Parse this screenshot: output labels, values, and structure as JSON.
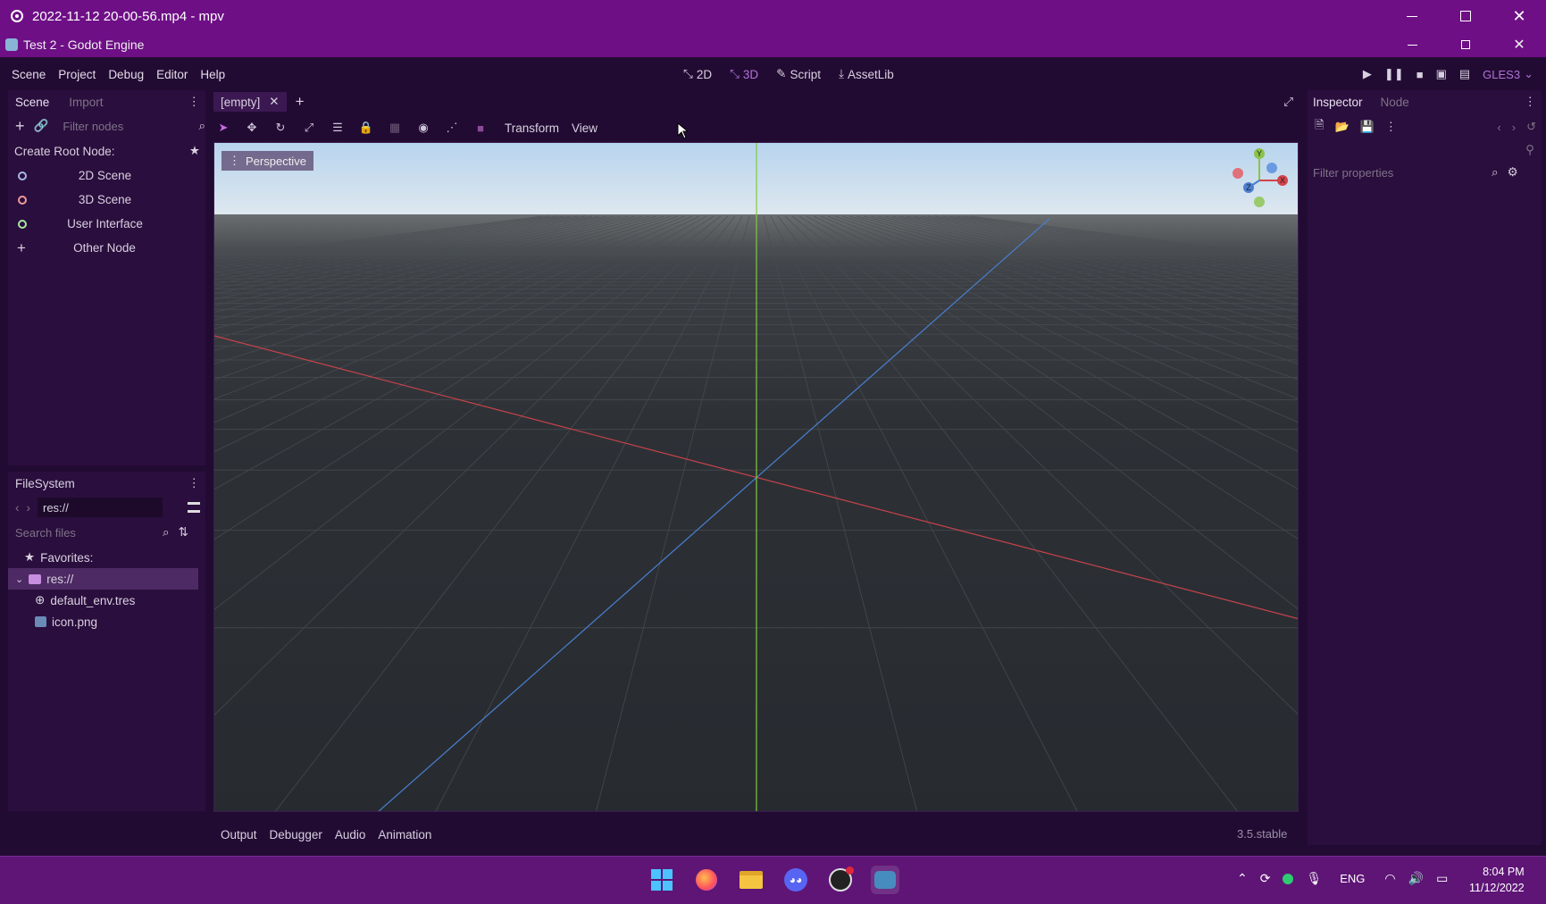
{
  "mpv": {
    "title": "2022-11-12 20-00-56.mp4 - mpv"
  },
  "godot": {
    "title": "Test 2 - Godot Engine"
  },
  "menu": [
    "Scene",
    "Project",
    "Debug",
    "Editor",
    "Help"
  ],
  "modes": {
    "m2d": "2D",
    "m3d": "3D",
    "script": "Script",
    "assetlib": "AssetLib"
  },
  "renderer": "GLES3",
  "scene_dock": {
    "tab_scene": "Scene",
    "tab_import": "Import",
    "filter_placeholder": "Filter nodes",
    "create_root": "Create Root Node:",
    "nodes": [
      "2D Scene",
      "3D Scene",
      "User Interface",
      "Other Node"
    ]
  },
  "filesystem": {
    "title": "FileSystem",
    "path": "res://",
    "search_placeholder": "Search files",
    "favorites": "Favorites:",
    "root": "res://",
    "files": [
      "default_env.tres",
      "icon.png"
    ]
  },
  "editor_tab": {
    "name": "[empty]"
  },
  "toolbar3d": {
    "transform": "Transform",
    "view": "View"
  },
  "viewport": {
    "perspective": "Perspective",
    "gizmo": {
      "x": "X",
      "y": "Y",
      "z": "Z"
    }
  },
  "inspector": {
    "tab_inspector": "Inspector",
    "tab_node": "Node",
    "filter_placeholder": "Filter properties"
  },
  "bottom": {
    "tabs": [
      "Output",
      "Debugger",
      "Audio",
      "Animation"
    ],
    "version": "3.5.stable"
  },
  "taskbar": {
    "lang": "ENG",
    "time": "8:04 PM",
    "date": "11/12/2022"
  },
  "colors": {
    "accent": "#6e0f86",
    "panel": "#2a0e3d",
    "x_axis": "#d4424a",
    "z_axis": "#4a7fd1",
    "y_axis": "#7fcb3a"
  }
}
